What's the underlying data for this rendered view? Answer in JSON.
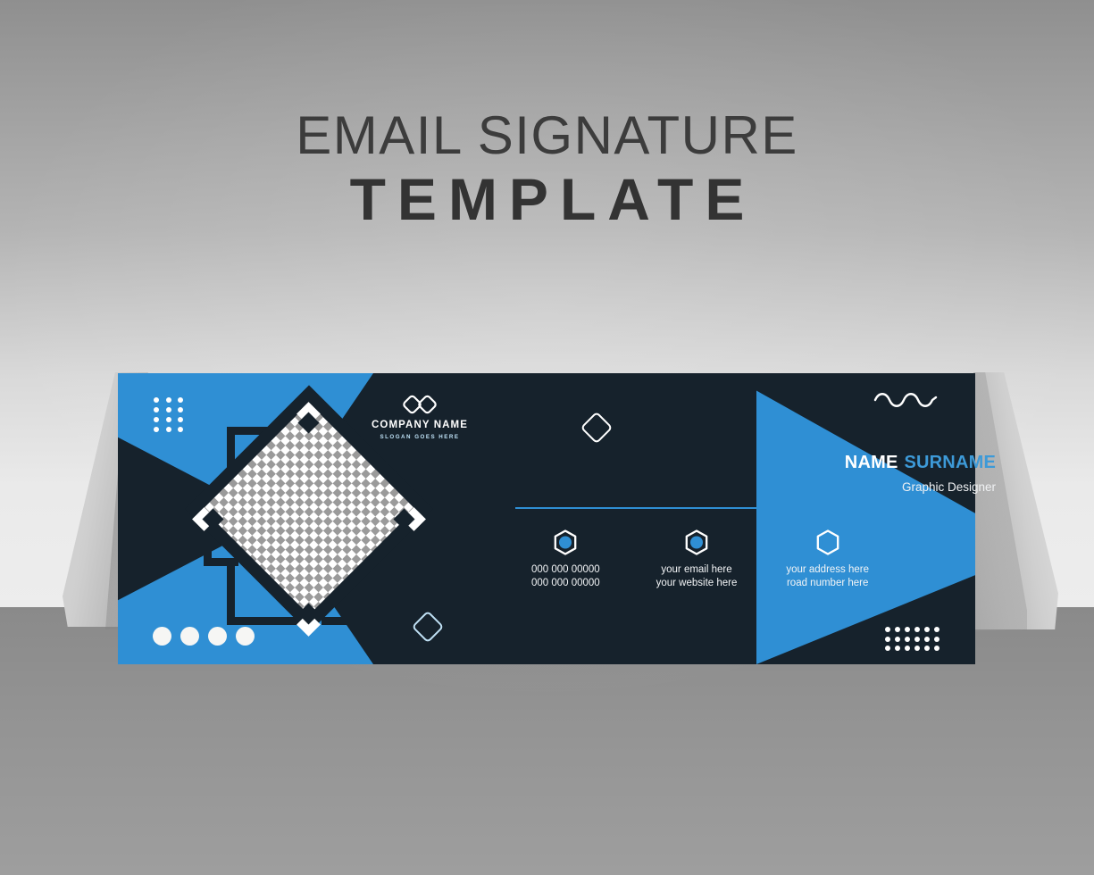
{
  "headline": {
    "line1": "EMAIL SIGNATURE",
    "line2": "TEMPLATE"
  },
  "colors": {
    "accent_blue": "#2f8fd4",
    "name_blue": "#3d9ad8",
    "dark_navy": "#16222c",
    "white": "#ffffff",
    "headline_gray": "#3c3c3c"
  },
  "banner": {
    "company": {
      "logo_icon": "overlapping-diamonds-logo-icon",
      "name": "COMPANY NAME",
      "slogan": "SLOGAN GOES HERE"
    },
    "photo_placeholder": {
      "label": "transparent-checkerboard-photo-placeholder"
    },
    "person": {
      "first_name": "NAME",
      "last_name": "SURNAME",
      "job_title": "Graphic Designer"
    },
    "contacts": [
      {
        "icon": "phone-hexagon-icon",
        "line1": "000 000 00000",
        "line2": "000 000 00000"
      },
      {
        "icon": "email-hexagon-icon",
        "line1": "your email here",
        "line2": "your website here"
      },
      {
        "icon": "location-hexagon-icon",
        "line1": "your address here",
        "line2": "road number here"
      }
    ],
    "decorations": {
      "dot_grid_top_left": "dot-grid-icon",
      "circles_bottom_left": "circle-row-icon",
      "dot_grid_bottom_right": "dot-grid-icon",
      "wave": "wave-line-icon",
      "mini_diamond_1": "diamond-outline-icon",
      "mini_diamond_2": "diamond-outline-icon"
    }
  }
}
